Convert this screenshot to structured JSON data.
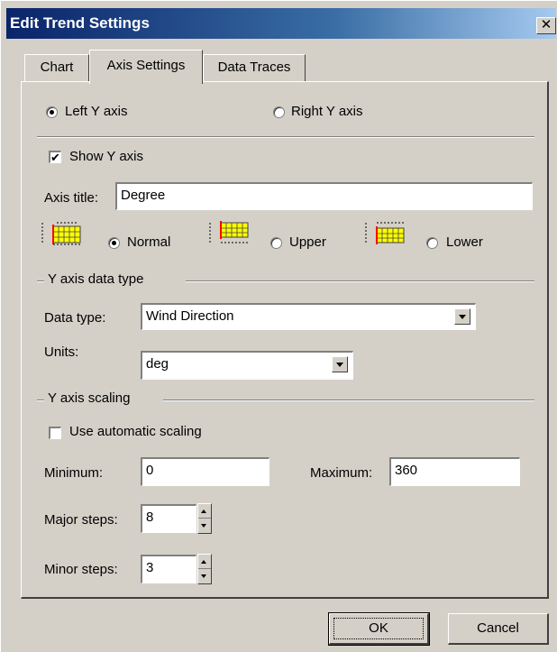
{
  "window": {
    "title": "Edit Trend Settings"
  },
  "tabs": [
    {
      "label": "Chart"
    },
    {
      "label": "Axis Settings"
    },
    {
      "label": "Data Traces"
    }
  ],
  "axis_side": {
    "left_label": "Left Y axis",
    "right_label": "Right Y axis",
    "selected": "left"
  },
  "show_y_axis": {
    "label": "Show Y axis",
    "checked": true
  },
  "axis_title": {
    "label": "Axis title:",
    "value": "Degree"
  },
  "position": {
    "normal_label": "Normal",
    "upper_label": "Upper",
    "lower_label": "Lower",
    "selected": "normal"
  },
  "data_type_group": {
    "title": "Y axis data type",
    "data_type_label": "Data type:",
    "data_type_value": "Wind Direction",
    "units_label": "Units:",
    "units_value": "deg"
  },
  "scaling_group": {
    "title": "Y axis scaling",
    "auto_label": "Use automatic scaling",
    "auto_checked": false,
    "minimum_label": "Minimum:",
    "minimum_value": "0",
    "maximum_label": "Maximum:",
    "maximum_value": "360",
    "major_label": "Major steps:",
    "major_value": "8",
    "minor_label": "Minor steps:",
    "minor_value": "3"
  },
  "buttons": {
    "ok_label": "OK",
    "cancel_label": "Cancel"
  },
  "colors": {
    "titlebar_start": "#0a246a",
    "titlebar_end": "#a6caf0",
    "dialog_face": "#d4d0c8",
    "graph_fill": "#ffff00",
    "graph_marker": "#ff0000"
  }
}
